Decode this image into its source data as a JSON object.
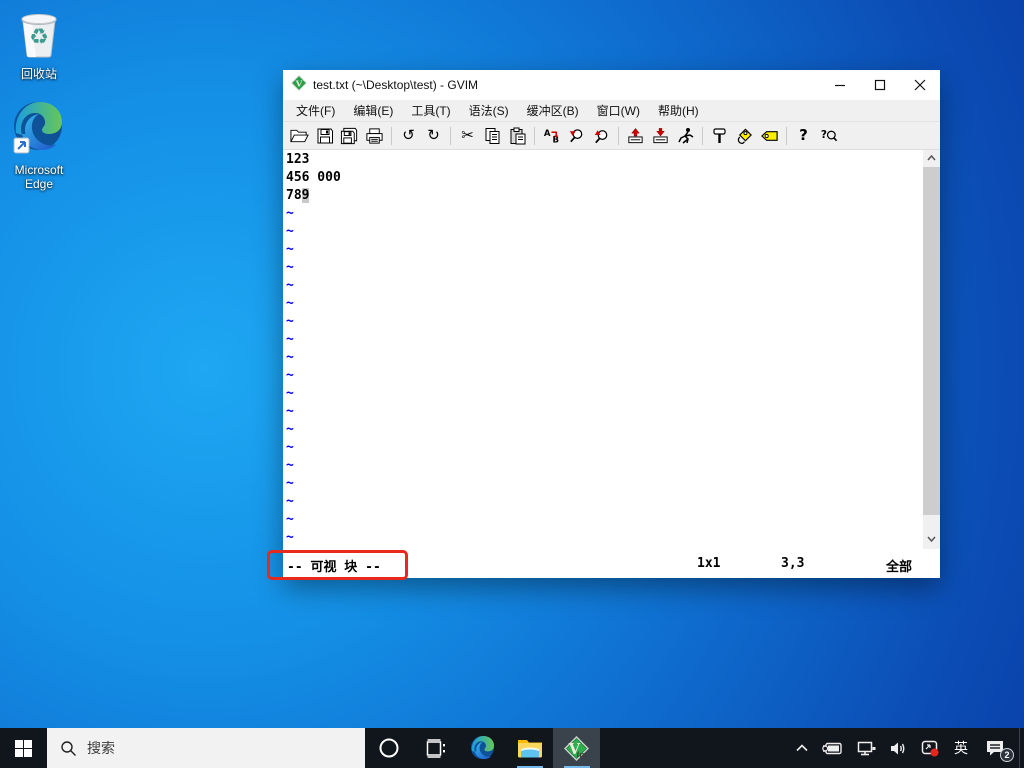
{
  "desktop": {
    "icons": [
      {
        "name": "recycle-bin",
        "label": "回收站"
      },
      {
        "name": "microsoft-edge",
        "label": "Microsoft Edge"
      }
    ]
  },
  "gvim": {
    "title": "test.txt (~\\Desktop\\test) - GVIM",
    "menus": [
      "文件(F)",
      "编辑(E)",
      "工具(T)",
      "语法(S)",
      "缓冲区(B)",
      "窗口(W)",
      "帮助(H)"
    ],
    "toolbar_icons": [
      "open",
      "save",
      "save-all",
      "print",
      "undo",
      "redo",
      "cut",
      "copy",
      "paste",
      "find-replace",
      "find-next",
      "find-prev",
      "session-load",
      "session-save",
      "run-script",
      "make",
      "build-tags",
      "tag-jump",
      "help",
      "find-help"
    ],
    "toolbar_glyphs": {
      "undo": "↺",
      "redo": "↻",
      "cut": "✂",
      "help": "?"
    },
    "buffer": {
      "line1": "123",
      "line2": "456 000",
      "line3_before_cursor": "78",
      "cursor_char": "9",
      "tilde": "~",
      "tilde_count": 19
    },
    "status": {
      "mode": "-- 可视 块 --",
      "selection_size": "1x1",
      "cursor_position": "3,3",
      "scroll_position": "全部"
    }
  },
  "annotation": {
    "shape": "red-rectangle",
    "color": "#e8291d",
    "highlights": "-- 可视 块 --"
  },
  "taskbar": {
    "search_placeholder": "搜索",
    "ime_indicator": "英",
    "notification_count": "2"
  },
  "colors": {
    "taskbar": "#11151c",
    "taskbar_underline": "#76b9ed",
    "tilde_blue": "#0000ee",
    "annotation_red": "#e8291d",
    "selection_gray": "#c9c9c9"
  }
}
